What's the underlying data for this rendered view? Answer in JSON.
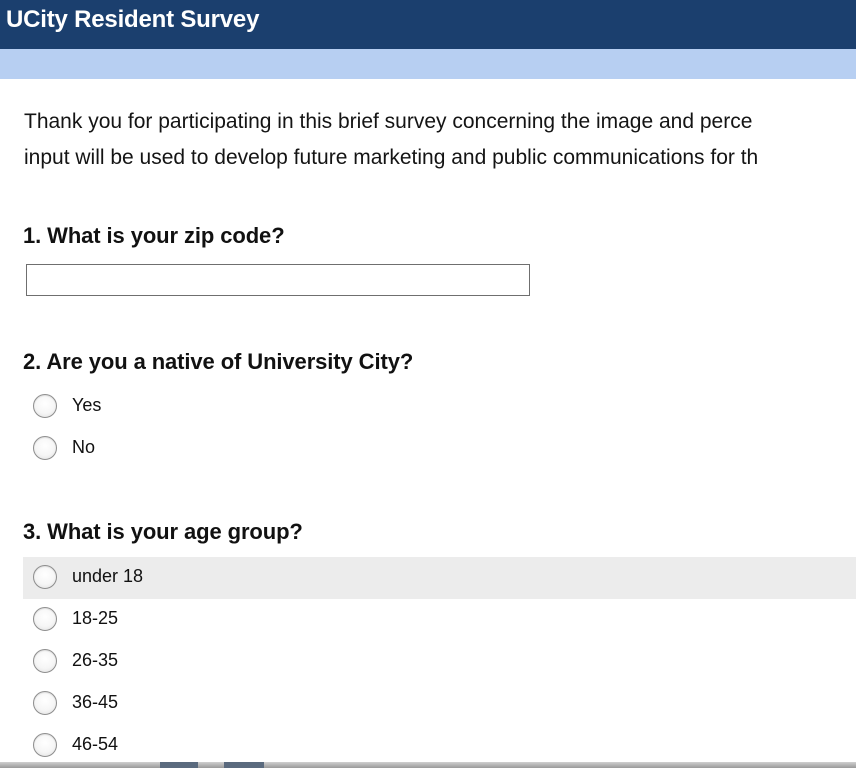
{
  "header": {
    "title": "UCity Resident Survey"
  },
  "intro": {
    "line1": "Thank you for participating in this brief survey concerning the image and perce",
    "line2": "input will be used to develop future marketing and public communications for th"
  },
  "questions": [
    {
      "label": "1. What is your zip code?",
      "input_value": "",
      "input_placeholder": ""
    },
    {
      "label": "2. Are you a native of University City?",
      "options": [
        "Yes",
        "No"
      ]
    },
    {
      "label": "3. What is your age group?",
      "options": [
        "under 18",
        "18-25",
        "26-35",
        "36-45",
        "46-54"
      ],
      "highlighted_option": "under 18"
    }
  ],
  "colors": {
    "title_bar": "#1b3f6e",
    "sub_bar": "#b7cff2",
    "row_highlight": "#ececec"
  }
}
